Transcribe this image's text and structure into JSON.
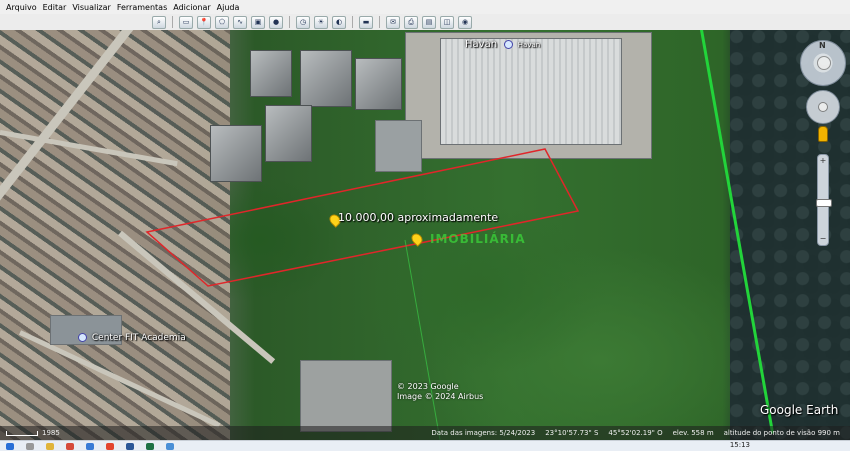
{
  "menu": [
    "Arquivo",
    "Editar",
    "Visualizar",
    "Ferramentas",
    "Adicionar",
    "Ajuda"
  ],
  "map": {
    "placemark_label": "10.000,00 aproximadamente",
    "watermark_text": "IMOBILIÁRIA",
    "poi_havan_label": "Havan",
    "poi_havan_sign": "Havan",
    "poi_academia_label": "Center FIT Academia",
    "copyright_lines": [
      "© 2023 Google",
      "Image © 2024 Airbus"
    ],
    "logo_text": "Google Earth",
    "nav_north": "N"
  },
  "status": {
    "year": "1985",
    "imagery_date": "Data das imagens: 5/24/2023",
    "lat": "23°10'57.73\" S",
    "lon": "45°52'02.19\" O",
    "elev": "elev.   558 m",
    "eye_alt": "altitude do ponto de visão   990 m"
  },
  "taskbar": {
    "clock": "15:13"
  },
  "colors": {
    "parcel_outline": "#e0262a",
    "boundary_line": "#22d43a",
    "pin": "#ffd21a"
  }
}
